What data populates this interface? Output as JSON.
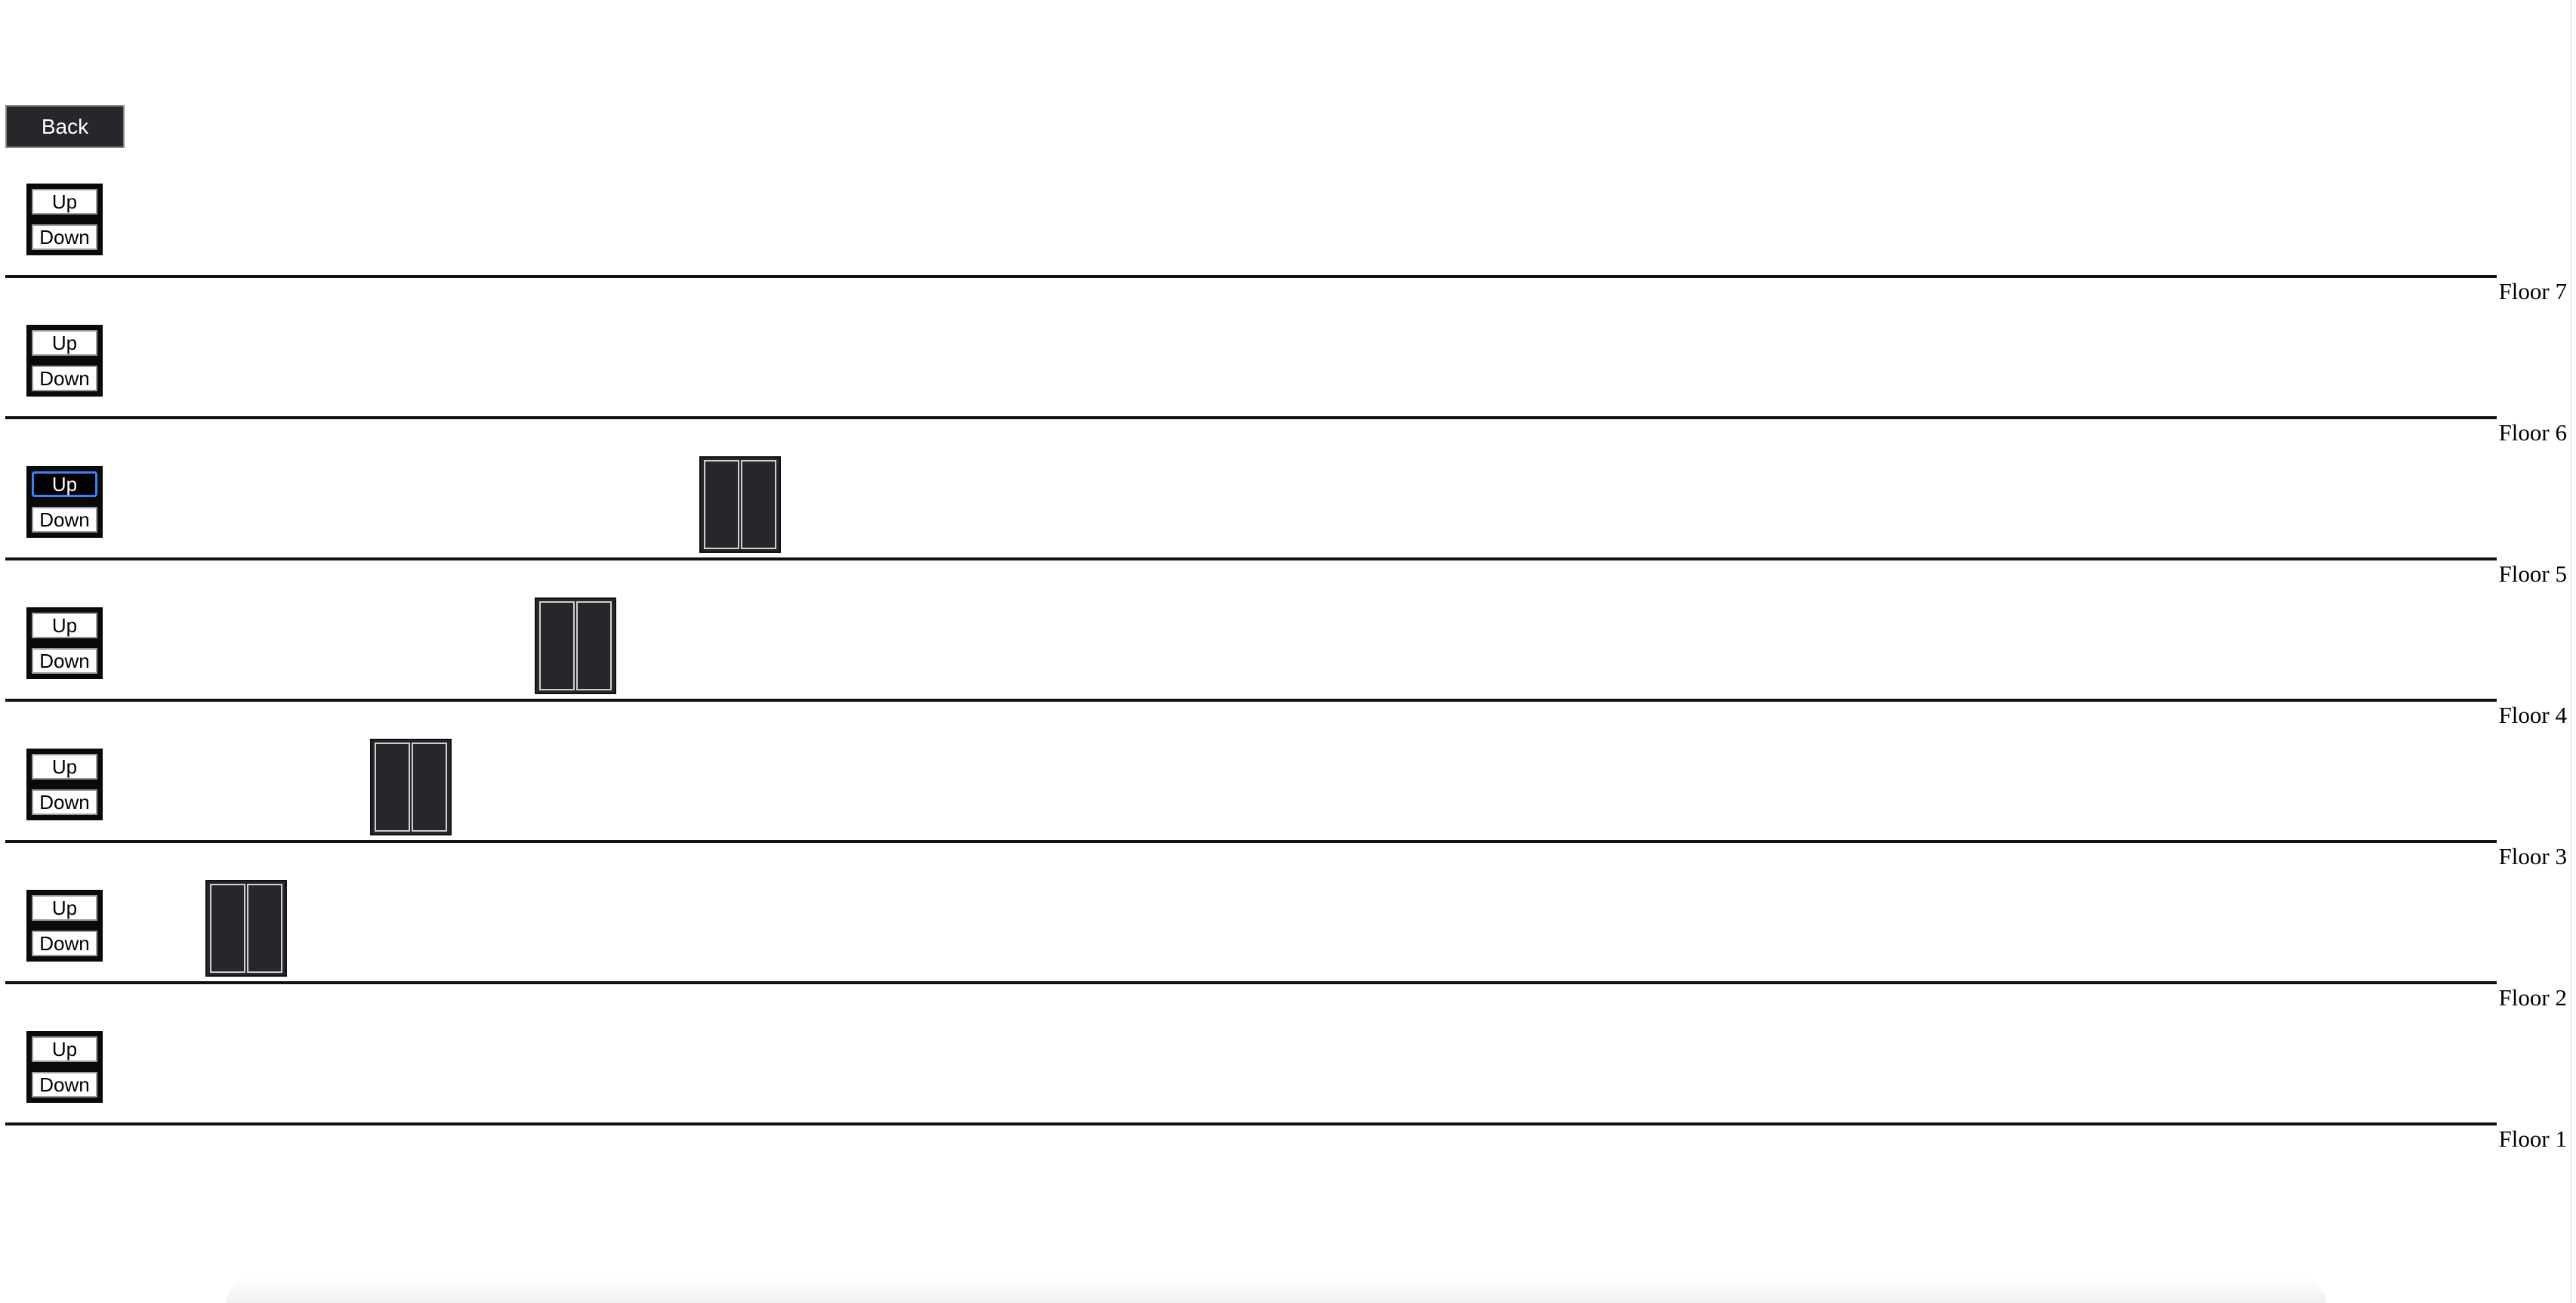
{
  "header": {
    "back_label": "Back"
  },
  "floors": [
    {
      "label": "Floor 7",
      "up_label": "Up",
      "down_label": "Down",
      "up_active": false
    },
    {
      "label": "Floor 6",
      "up_label": "Up",
      "down_label": "Down",
      "up_active": false
    },
    {
      "label": "Floor 5",
      "up_label": "Up",
      "down_label": "Down",
      "up_active": true
    },
    {
      "label": "Floor 4",
      "up_label": "Up",
      "down_label": "Down",
      "up_active": false
    },
    {
      "label": "Floor 3",
      "up_label": "Up",
      "down_label": "Down",
      "up_active": false
    },
    {
      "label": "Floor 2",
      "up_label": "Up",
      "down_label": "Down",
      "up_active": false
    },
    {
      "label": "Floor 1",
      "up_label": "Up",
      "down_label": "Down",
      "up_active": false
    }
  ],
  "elevators": [
    {
      "id": 1,
      "floor": 2
    },
    {
      "id": 2,
      "floor": 3
    },
    {
      "id": 3,
      "floor": 4
    },
    {
      "id": 4,
      "floor": 5
    }
  ],
  "colors": {
    "elevator": "#25272b",
    "button_active": "#000000",
    "focus_ring": "#3b82f6"
  }
}
